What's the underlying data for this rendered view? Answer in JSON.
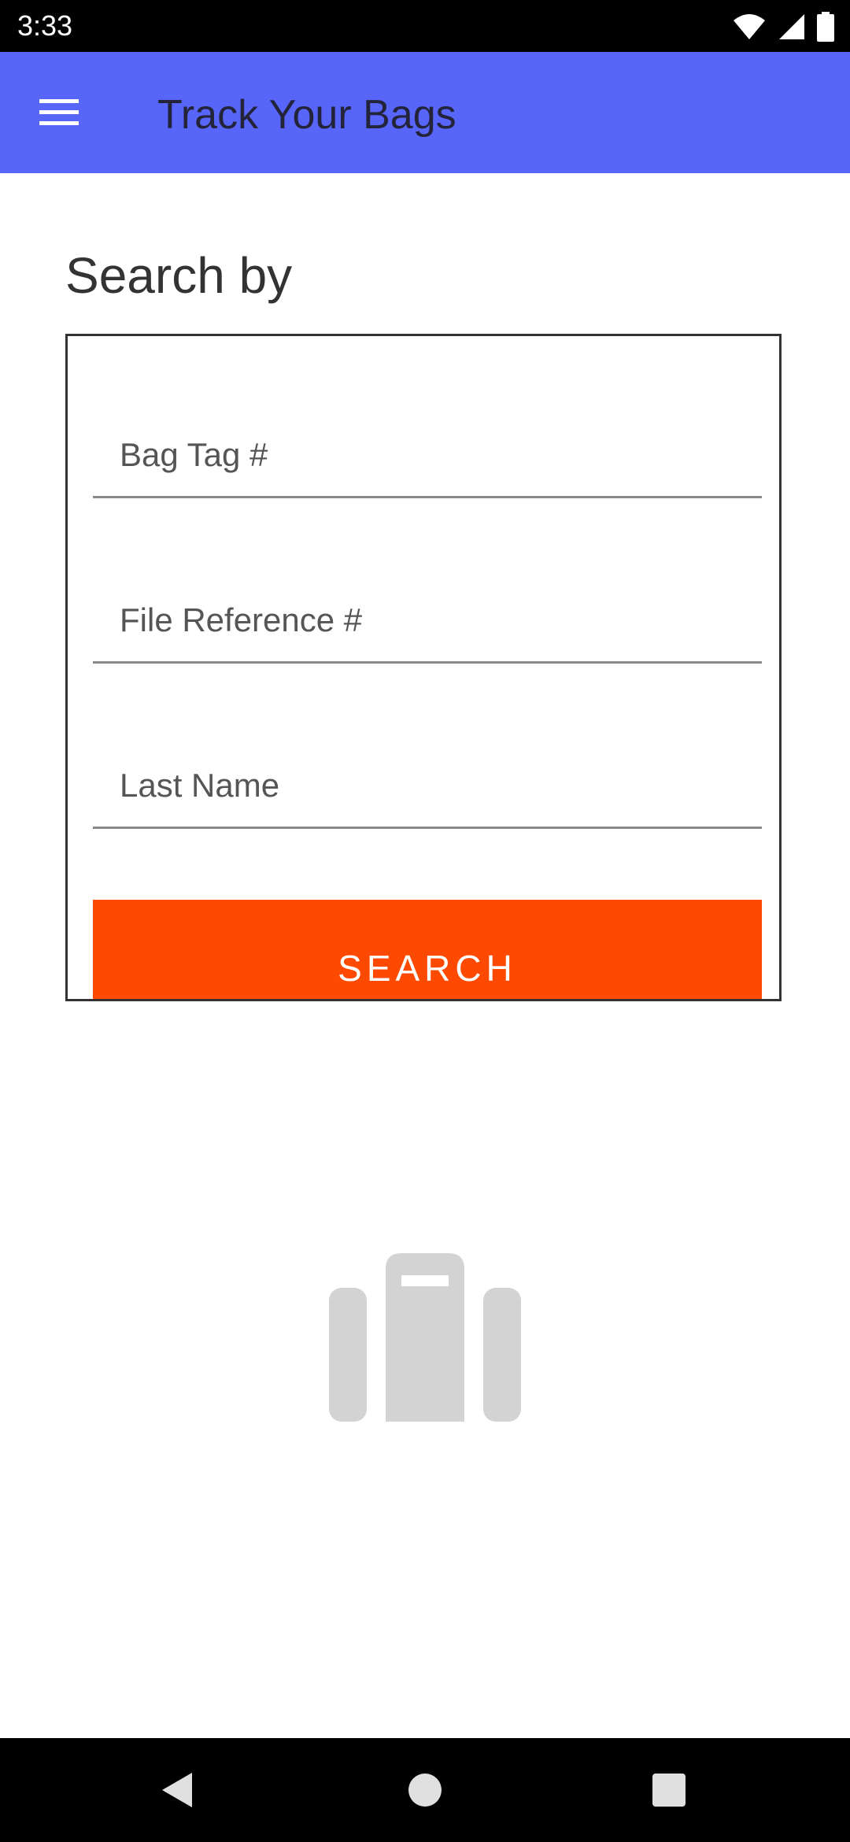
{
  "status_bar": {
    "time": "3:33",
    "icons": [
      "wifi-icon",
      "cell-signal-icon",
      "battery-icon"
    ]
  },
  "app_bar": {
    "title": "Track Your Bags",
    "menu_icon": "hamburger-menu-icon",
    "background_color": "#5766f8"
  },
  "search": {
    "heading": "Search by",
    "fields": [
      {
        "label": "Bag Tag #",
        "value": ""
      },
      {
        "label": "File Reference #",
        "value": ""
      },
      {
        "label": "Last Name",
        "value": ""
      }
    ],
    "button_label": "SEARCH",
    "button_color": "#fe4a00"
  },
  "illustration": {
    "icon": "suitcase-icon",
    "color": "#d3d3d3"
  },
  "nav_bar": {
    "buttons": [
      "back-icon",
      "home-icon",
      "recents-icon"
    ]
  }
}
